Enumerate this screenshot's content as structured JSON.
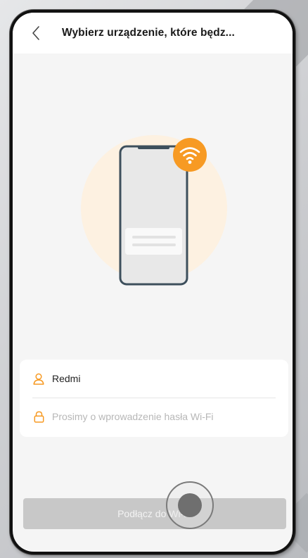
{
  "header": {
    "title": "Wybierz urządzenie, które będz..."
  },
  "form": {
    "ssid_value": "Redmi",
    "password_placeholder": "Prosimy o wprowadzenie hasła Wi-Fi"
  },
  "actions": {
    "connect_label": "Podłącz do Wi-Fi"
  },
  "icons": {
    "back": "chevron-left-icon",
    "user": "user-icon",
    "lock": "lock-icon",
    "wifi": "wifi-icon"
  },
  "colors": {
    "accent": "#f79a23",
    "accent_light": "#fdf1e1",
    "button_disabled": "#c8c8c8",
    "phone_outline": "#3d4f5c"
  }
}
